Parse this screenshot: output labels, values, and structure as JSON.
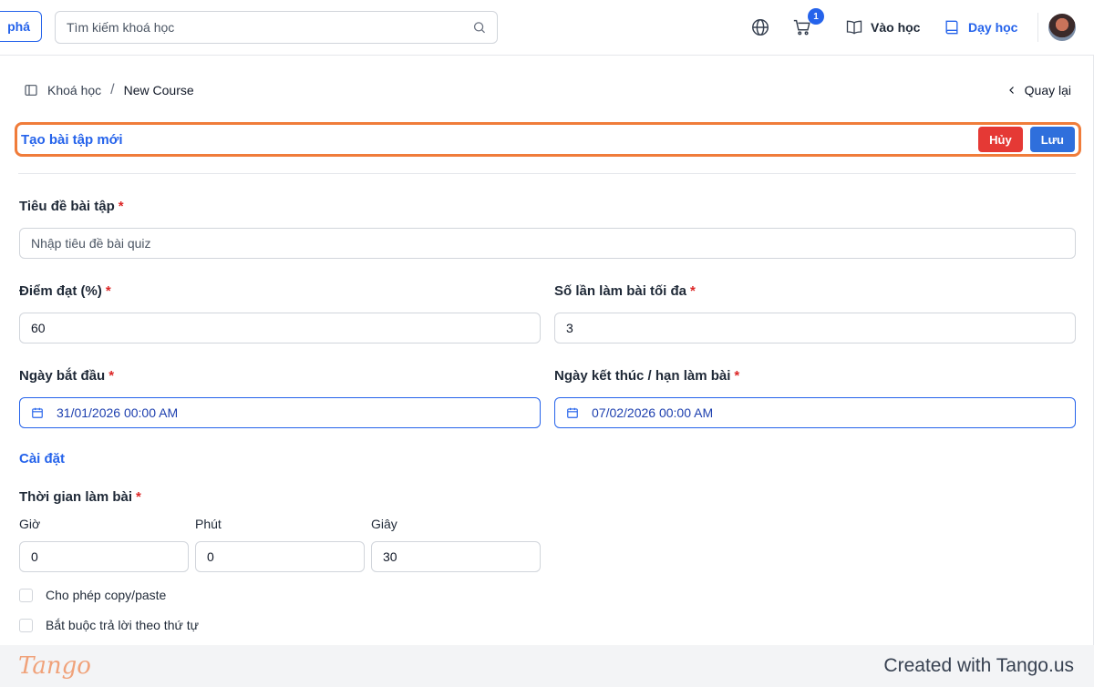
{
  "header": {
    "explore_label": "phá",
    "search_placeholder": "Tìm kiếm khoá học",
    "cart_count": "1",
    "learn_label": "Vào học",
    "teach_label": "Dạy học"
  },
  "breadcrumb": {
    "root": "Khoá học",
    "separator": "/",
    "current": "New Course",
    "back_label": "Quay lại"
  },
  "form": {
    "title": "Tạo bài tập mới",
    "cancel_label": "Hủy",
    "save_label": "Lưu",
    "required_mark": "*",
    "title_field": {
      "label": "Tiêu đề bài tập",
      "placeholder": "Nhập tiêu đề bài quiz",
      "value": ""
    },
    "pass_score": {
      "label": "Điểm đạt (%)",
      "value": "60"
    },
    "max_attempts": {
      "label": "Số lần làm bài tối đa",
      "value": "3"
    },
    "start_date": {
      "label": "Ngày bắt đầu",
      "value": "31/01/2026 00:00 AM"
    },
    "end_date": {
      "label": "Ngày kết thúc / hạn làm bài",
      "value": "07/02/2026 00:00 AM"
    },
    "settings_heading": "Cài đặt",
    "duration": {
      "label": "Thời gian làm bài",
      "hours_label": "Giờ",
      "hours": "0",
      "minutes_label": "Phút",
      "minutes": "0",
      "seconds_label": "Giây",
      "seconds": "30"
    },
    "options": [
      {
        "label": "Cho phép copy/paste",
        "checked": false
      },
      {
        "label": "Bắt buộc trả lời theo thứ tự",
        "checked": false
      }
    ]
  },
  "footer": {
    "logo_text": "Tango",
    "credit": "Created with Tango.us"
  },
  "colors": {
    "primary": "#2563eb",
    "danger": "#e53935",
    "highlight": "#f07c3a"
  }
}
